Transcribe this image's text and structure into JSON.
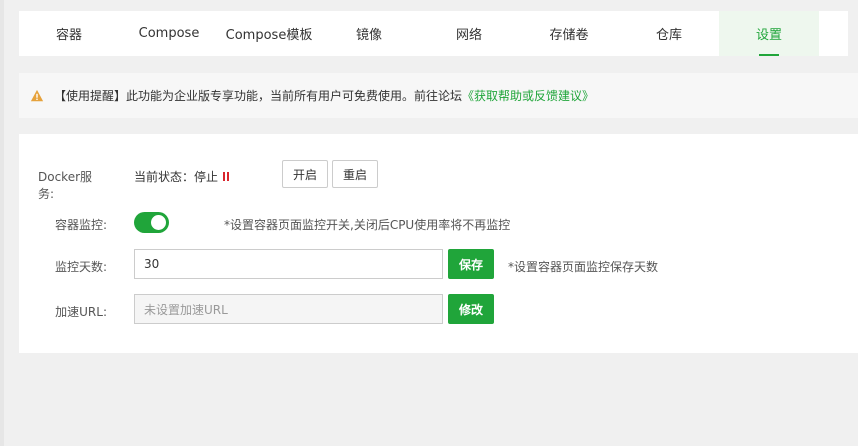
{
  "tabs": [
    {
      "label": "容器"
    },
    {
      "label": "Compose"
    },
    {
      "label": "Compose模板"
    },
    {
      "label": "镜像"
    },
    {
      "label": "网络"
    },
    {
      "label": "存储卷"
    },
    {
      "label": "仓库"
    },
    {
      "label": "设置",
      "active": true
    }
  ],
  "notice": {
    "text": "【使用提醒】此功能为企业版专享功能，当前所有用户可免费使用。前往论坛",
    "link": "《获取帮助或反馈建议》",
    "icon": "warning-icon",
    "icon_color": "#e6a23c"
  },
  "settings": {
    "docker_service": {
      "label": "Docker服务:",
      "status": "当前状态：停止",
      "status_icon": "pause-icon",
      "start_button": "开启",
      "restart_button": "重启"
    },
    "monitor": {
      "label": "容器监控:",
      "enabled": true,
      "hint": "*设置容器页面监控开关,关闭后CPU使用率将不再监控"
    },
    "monitor_days": {
      "label": "监控天数:",
      "value": "30",
      "save_button": "保存",
      "hint": "*设置容器页面监控保存天数"
    },
    "accel_url": {
      "label": "加速URL:",
      "placeholder": "未设置加速URL",
      "modify_button": "修改"
    }
  },
  "colors": {
    "accent": "#20a53a",
    "stop": "#d9262d"
  }
}
